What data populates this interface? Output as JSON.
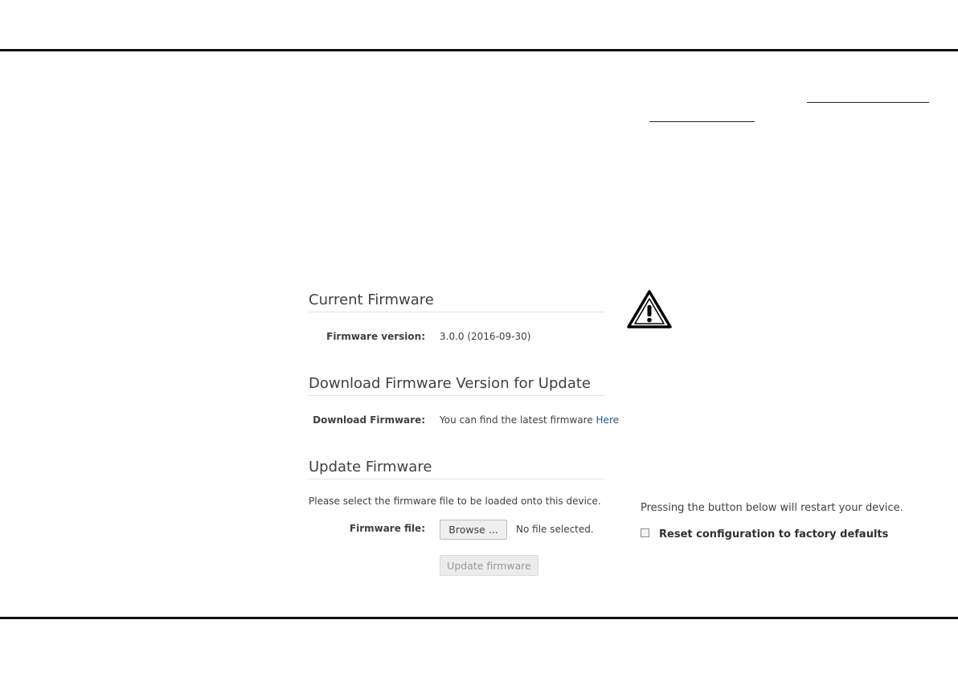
{
  "current_firmware": {
    "title": "Current Firmware",
    "version_label": "Firmware version:",
    "version_value": "3.0.0 (2016-09-30)"
  },
  "download_firmware": {
    "title": "Download Firmware Version for Update",
    "label": "Download Firmware:",
    "text": "You can find the latest firmware ",
    "link_text": "Here"
  },
  "update_firmware": {
    "title": "Update Firmware",
    "description": "Please select the firmware file to be loaded onto this device.",
    "file_label": "Firmware file:",
    "browse_label": "Browse ...",
    "no_file_text": "No file selected.",
    "update_button_label": "Update firmware"
  },
  "restart": {
    "text": "Pressing the button below will restart your device.",
    "reset_label": "Reset configuration to factory defaults"
  },
  "icons": {
    "warning": "warning-triangle-icon"
  }
}
